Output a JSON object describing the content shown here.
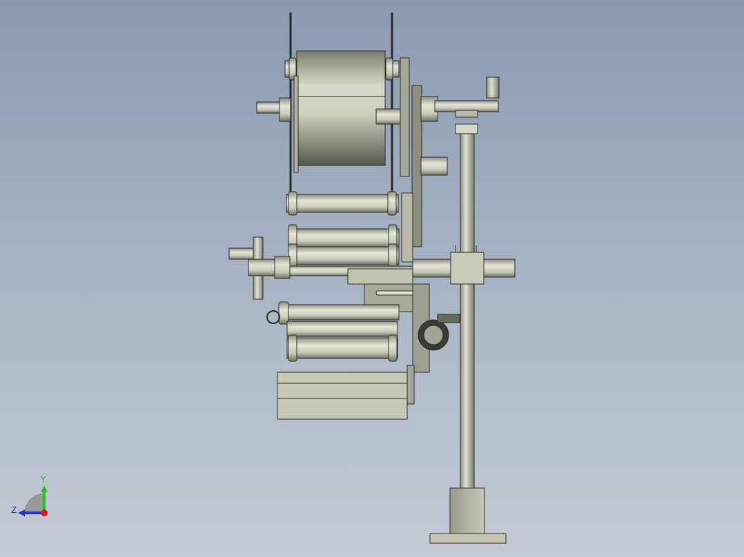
{
  "viewport": {
    "background_top": "#8a9ab0",
    "background_bottom": "#c4cbd6"
  },
  "model": {
    "body_color": "#c9cab8",
    "shadow_color": "#8e8f80",
    "edge_color": "#2b2b25",
    "dark_part_color": "#6f7068"
  },
  "triad": {
    "y_label": "Y",
    "z_label": "Z",
    "y_color": "#21c21f",
    "z_color": "#2233cc",
    "origin_color": "#e01818"
  }
}
